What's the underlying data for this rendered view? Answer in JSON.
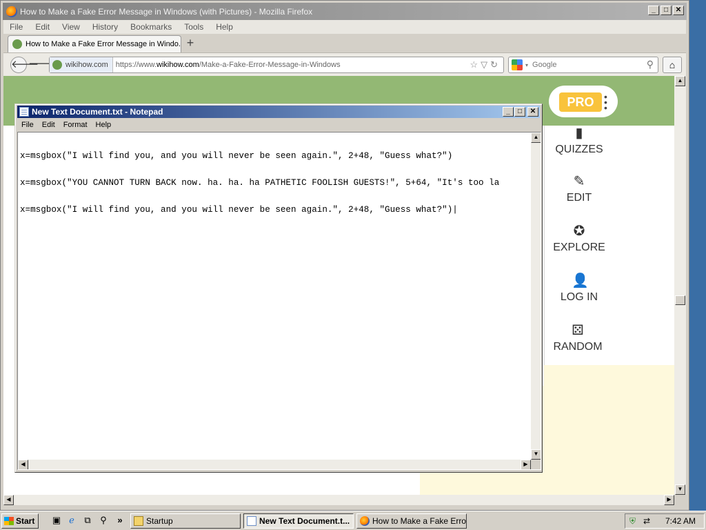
{
  "firefox": {
    "title": "How to Make a Fake Error Message in Windows (with Pictures) - Mozilla Firefox",
    "menu": [
      "File",
      "Edit",
      "View",
      "History",
      "Bookmarks",
      "Tools",
      "Help"
    ],
    "tab_title": "How to Make a Fake Error Message in Windo...",
    "new_tab": "+",
    "site_identity": "wikihow.com",
    "url_prefix": "https://www.",
    "url_domain": "wikihow.com",
    "url_path": "/Make-a-Fake-Error-Message-in-Windows",
    "search_placeholder": "Google"
  },
  "wikihow": {
    "pro_label": "PRO",
    "nav": [
      {
        "label": "QUIZZES",
        "icon": "quiz-icon"
      },
      {
        "label": "EDIT",
        "icon": "pencil-icon"
      },
      {
        "label": "EXPLORE",
        "icon": "compass-icon"
      },
      {
        "label": "LOG IN",
        "icon": "user-icon"
      },
      {
        "label": "RANDOM",
        "icon": "dice-icon"
      }
    ],
    "colors": {
      "header": "#93b874",
      "pro_badge": "#f9c33c",
      "cream": "#fef9dc"
    }
  },
  "notepad": {
    "title": "New Text Document.txt - Notepad",
    "menu": [
      "File",
      "Edit",
      "Format",
      "Help"
    ],
    "lines": [
      "x=msgbox(\"I will find you, and you will never be seen again.\", 2+48, \"Guess what?\")",
      "x=msgbox(\"YOU CANNOT TURN BACK now. ha. ha. ha PATHETIC FOOLISH GUESTS!\", 5+64, \"It's too la",
      "x=msgbox(\"I will find you, and you will never be seen again.\", 2+48, \"Guess what?\")|"
    ]
  },
  "taskbar": {
    "start_label": "Start",
    "quick_launch_more": "»",
    "buttons": [
      {
        "label": "Startup",
        "icon": "folder-icon"
      },
      {
        "label": "New Text Document.t...",
        "icon": "notepad-icon"
      },
      {
        "label": "How to Make a Fake Error...",
        "icon": "firefox-icon"
      }
    ],
    "clock": "7:42 AM"
  }
}
